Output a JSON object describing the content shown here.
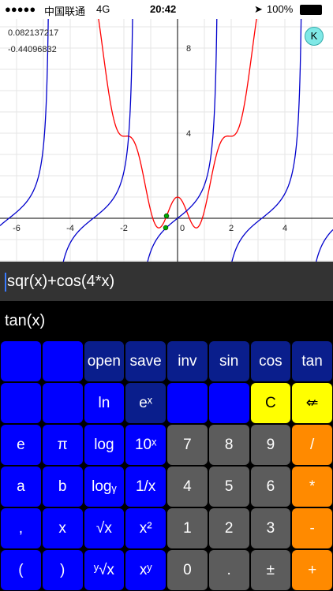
{
  "status_bar": {
    "carrier": "中国联通",
    "network": "4G",
    "time": "20:42",
    "battery": "100%"
  },
  "graph": {
    "coord_x": "0.082137217",
    "coord_y": "-0.44096832",
    "k_button": "K",
    "x_ticks": [
      "-6",
      "-4",
      "-2",
      "0",
      "2",
      "4"
    ],
    "y_ticks": [
      "8",
      "4"
    ],
    "colors": {
      "red_curve": "#ff0000",
      "blue_curve": "#0000cc",
      "point": "#0a0"
    }
  },
  "chart_data": {
    "type": "line",
    "series": [
      {
        "name": "sqr(x)+cos(4*x)",
        "color": "#ff0000"
      },
      {
        "name": "tan(x)",
        "color": "#0000cc"
      }
    ],
    "xlim": [
      -6.6,
      5.8
    ],
    "ylim": [
      -2.5,
      12
    ],
    "grid": true
  },
  "expressions": {
    "line1": "sqr(x)+cos(4*x)",
    "line2": "tan(x)"
  },
  "keypad": {
    "rows": [
      [
        "",
        "",
        "open",
        "save",
        "inv",
        "sin",
        "cos",
        "tan"
      ],
      [
        "",
        "",
        "ln",
        "eˣ",
        "",
        "",
        "C",
        "⇍"
      ],
      [
        "e",
        "π",
        "log",
        "10ˣ",
        "7",
        "8",
        "9",
        "/"
      ],
      [
        "a",
        "b",
        "logᵧ",
        "1/x",
        "4",
        "5",
        "6",
        "*"
      ],
      [
        ",",
        "x",
        "√x",
        "x²",
        "1",
        "2",
        "3",
        "-"
      ],
      [
        "(",
        ")",
        "ʸ√x",
        "xʸ",
        "0",
        ".",
        "±",
        "+"
      ]
    ]
  }
}
